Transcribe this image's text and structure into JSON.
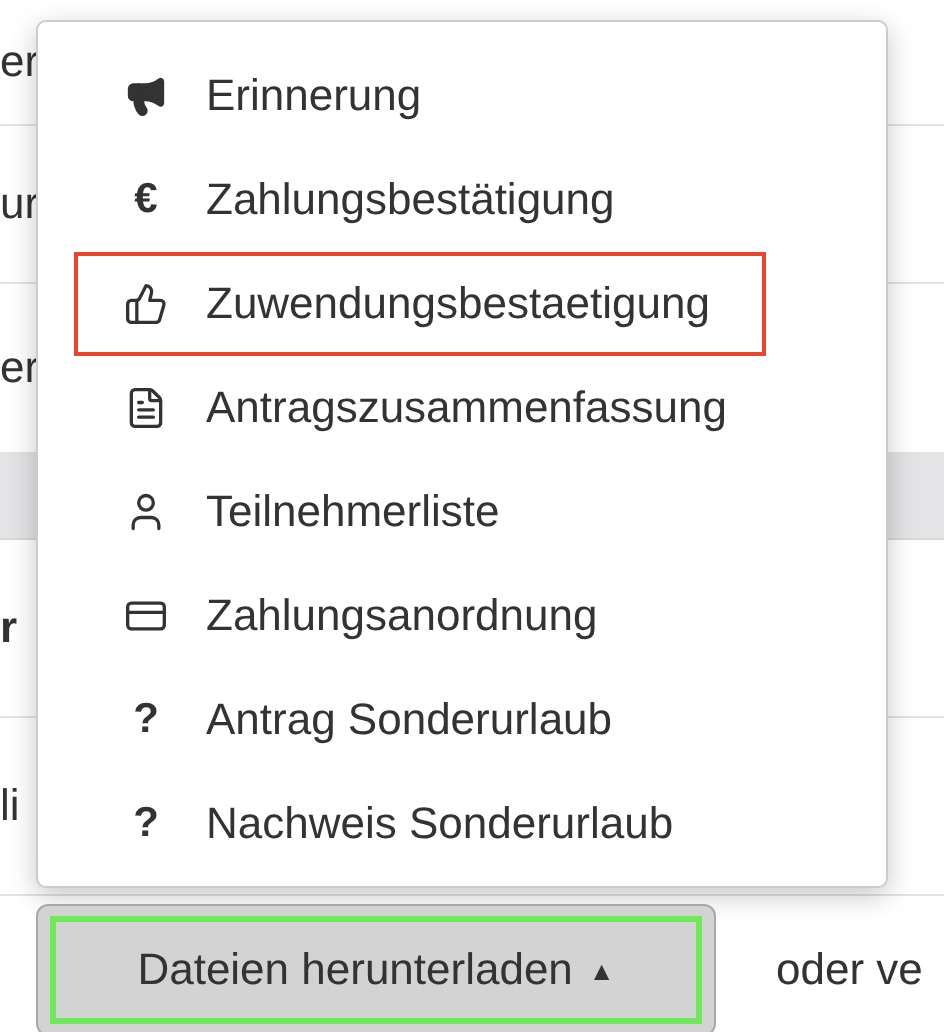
{
  "table_rows": [
    {
      "text": "er",
      "bold": false
    },
    {
      "text": "ur",
      "bold": false
    },
    {
      "text": "er",
      "bold": false
    },
    {
      "kind": "band"
    },
    {
      "text": "r",
      "bold": true
    },
    {
      "text": "li",
      "bold": false
    }
  ],
  "menu": {
    "items": [
      {
        "kind": "megaphone",
        "label": "Erinnerung",
        "highlighted": false
      },
      {
        "glyph": "€",
        "label": "Zahlungsbestätigung",
        "highlighted": false
      },
      {
        "kind": "thumbs-up",
        "label": "Zuwendungsbestaetigung",
        "highlighted": true
      },
      {
        "kind": "document",
        "label": "Antragszusammenfassung",
        "highlighted": false
      },
      {
        "kind": "person",
        "label": "Teilnehmerliste",
        "highlighted": false
      },
      {
        "kind": "card",
        "label": "Zahlungsanordnung",
        "highlighted": false
      },
      {
        "glyph": "?",
        "label": "Antrag Sonderurlaub",
        "highlighted": false
      },
      {
        "glyph": "?",
        "label": "Nachweis Sonderurlaub",
        "highlighted": false
      }
    ]
  },
  "download_button": {
    "label": "Dateien herunterladen",
    "caret": "▲",
    "highlighted": true
  },
  "trailing_text": "oder ve"
}
